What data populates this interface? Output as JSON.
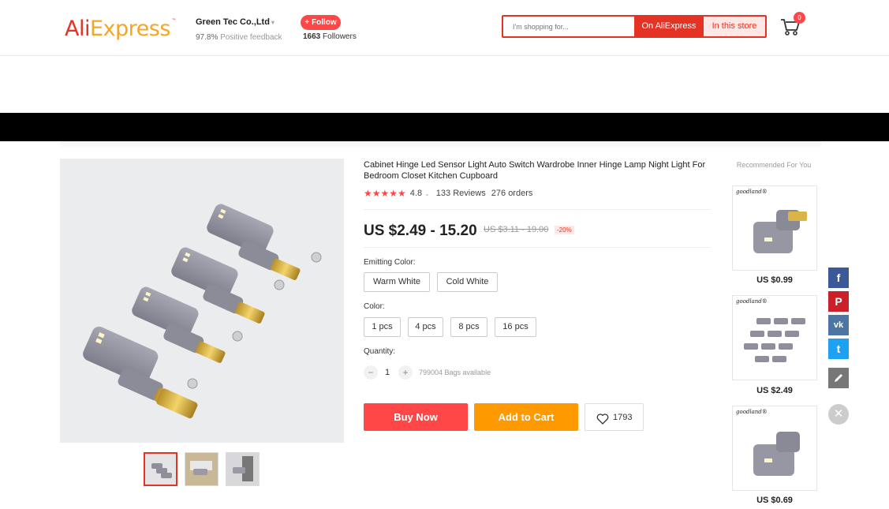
{
  "header": {
    "logo_part1": "Ali",
    "logo_part2": "Express",
    "logo_tm": "™",
    "store_name": "Green Tec Co.,Ltd",
    "feedback_pct": "97.8%",
    "feedback_label": "Positive feedback",
    "follow_label": "+ Follow",
    "followers_count": "1663",
    "followers_label": "Followers",
    "search_placeholder": "I'm shopping for...",
    "search_btn_ali": "On AliExpress",
    "search_btn_store": "In this store",
    "cart_count": "0"
  },
  "product": {
    "title": "Cabinet Hinge Led Sensor Light Auto Switch Wardrobe Inner Hinge Lamp Night Light For Bedroom Closet Kitchen Cupboard",
    "stars": "★★★★★",
    "rating": "4.8",
    "reviews": "133 Reviews",
    "orders": "276 orders",
    "price": "US $2.49 - 15.20",
    "old_price": "US $3.11 - 19.00",
    "discount": "-20%",
    "emitting_color_label": "Emitting Color:",
    "emitting_colors": [
      "Warm White",
      "Cold White"
    ],
    "color_label": "Color:",
    "colors": [
      "1 pcs",
      "4 pcs",
      "8 pcs",
      "16 pcs"
    ],
    "quantity_label": "Quantity:",
    "quantity": "1",
    "available": "799004 Bags available",
    "buy_now": "Buy Now",
    "add_to_cart": "Add to Cart",
    "wishlist_count": "1793"
  },
  "recommended": {
    "title": "Recommended For You",
    "items": [
      {
        "brand": "goodland®",
        "price": "US $0.99"
      },
      {
        "brand": "goodland®",
        "price": "US $2.49"
      },
      {
        "brand": "goodland®",
        "price": "US $0.69"
      }
    ]
  },
  "share": {
    "facebook": "f",
    "pinterest": "P",
    "vk": "vk",
    "twitter": "t"
  },
  "colors": {
    "brand_red": "#e43225",
    "buy_now": "#ff4747",
    "add_to_cart": "#ff9900",
    "facebook": "#3b5998",
    "pinterest": "#cb2027",
    "vk": "#4c75a3",
    "twitter": "#1da1f2"
  }
}
